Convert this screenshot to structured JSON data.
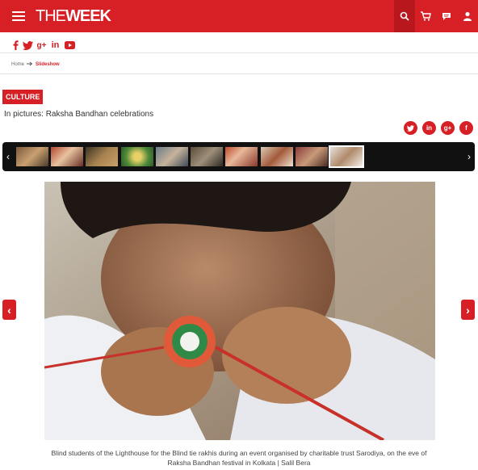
{
  "header": {
    "logo_the": "THE",
    "logo_week": "WEEK",
    "icons": [
      "search-icon",
      "cart-icon",
      "chat-icon",
      "user-icon"
    ],
    "accent": "#d71f26"
  },
  "social": {
    "icons": [
      "facebook-icon",
      "twitter-icon",
      "google-plus-icon",
      "linkedin-icon",
      "youtube-icon"
    ],
    "labels": [
      "f",
      "🐦",
      "g+",
      "in",
      "▶"
    ]
  },
  "breadcrumb": {
    "home": "Home",
    "current": "Slideshow"
  },
  "article": {
    "category": "CULTURE",
    "title": "In pictures: Raksha Bandhan celebrations"
  },
  "share": {
    "labels": [
      "t",
      "in",
      "g+",
      "f"
    ]
  },
  "strip": {
    "prev": "‹",
    "next": "›",
    "thumb_count_visible": 10,
    "active_index": 9
  },
  "slideshow": {
    "prev": "‹",
    "next": "›",
    "caption_line1": "Blind students of the Lighthouse for the Blind tie rakhis during an event organised by charitable trust Sarodiya, on the eve of",
    "caption_line2": "Raksha Bandhan festival in Kolkata | Salil Bera"
  }
}
